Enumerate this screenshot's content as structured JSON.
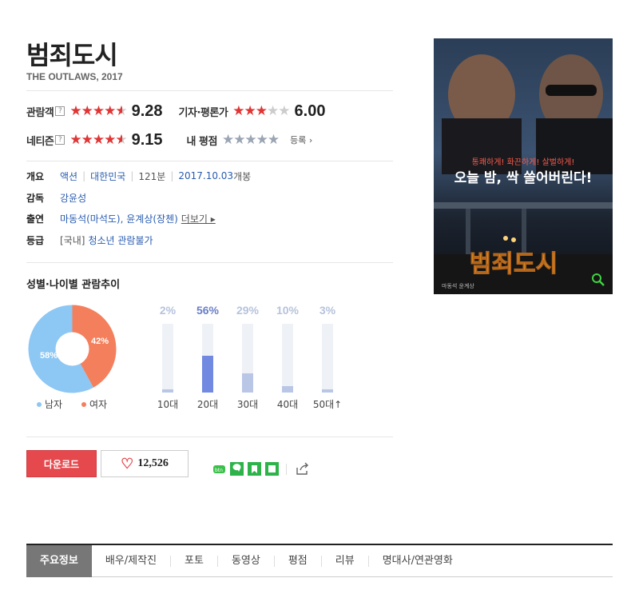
{
  "movie": {
    "title": "범죄도시",
    "subtitle": "THE OUTLAWS, 2017"
  },
  "ratings": {
    "audience": {
      "label": "관람객",
      "help": "?",
      "stars": 4.6,
      "score": "9.28"
    },
    "critics": {
      "label": "기자·평론가",
      "stars": 3.0,
      "score": "6.00"
    },
    "netizen": {
      "label": "네티즌",
      "help": "?",
      "stars": 4.6,
      "score": "9.15"
    },
    "mine": {
      "label": "내 평점",
      "action": "등록 ›"
    }
  },
  "info": {
    "overview": {
      "key": "개요",
      "genre": "액션",
      "country": "대한민국",
      "runtime": "121분",
      "release": "2017.10.03",
      "release_suffix": " 개봉"
    },
    "director": {
      "key": "감독",
      "name": "강윤성"
    },
    "cast": {
      "key": "출연",
      "text": "마동석(마석도), 윤계상(장첸)",
      "more": "더보기 ▸"
    },
    "rating": {
      "key": "등급",
      "prefix": "[국내]",
      "value": "청소년 관람불가"
    }
  },
  "demographics": {
    "title": "성별·나이별 관람추이",
    "gender": {
      "male": {
        "label": "남자",
        "pct": "58%",
        "value": 58,
        "color": "#8dc7f4"
      },
      "female": {
        "label": "여자",
        "pct": "42%",
        "value": 42,
        "color": "#f47f5d"
      }
    },
    "age": [
      {
        "label": "10대",
        "pct": "2%",
        "value": 2
      },
      {
        "label": "20대",
        "pct": "56%",
        "value": 56,
        "highlight": true
      },
      {
        "label": "30대",
        "pct": "29%",
        "value": 29
      },
      {
        "label": "40대",
        "pct": "10%",
        "value": 10
      },
      {
        "label": "50대",
        "pct": "3%",
        "value": 3,
        "suffix": "↑"
      }
    ]
  },
  "actions": {
    "download": "다운로드",
    "likes": "12,526"
  },
  "poster": {
    "tagline": "오늘 밤, 싹 쓸어버린다!",
    "small_line": "통쾌하게! 화끈하게! 살벌하게!",
    "title": "범죄도시",
    "credits": "마동석 윤계상"
  },
  "tabs": [
    "주요정보",
    "배우/제작진",
    "포토",
    "동영상",
    "평점",
    "리뷰",
    "명대사/연관영화"
  ]
}
